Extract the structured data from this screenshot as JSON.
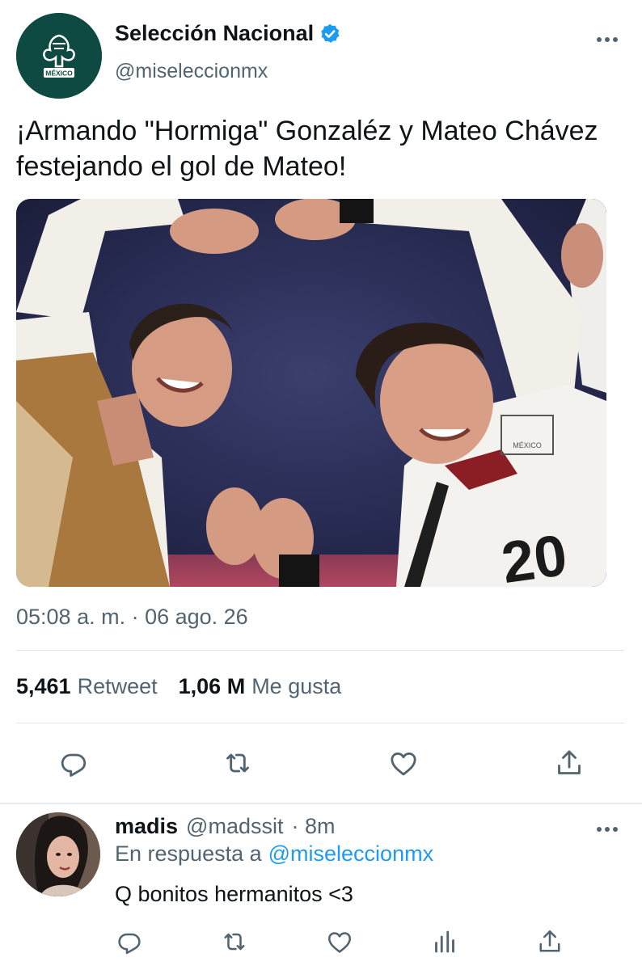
{
  "tweet": {
    "display_name": "Selección Nacional",
    "handle": "@miseleccionmx",
    "avatar_text": "MÉXICO",
    "text": "¡Armando \"Hormiga\" Gonzaléz y Mateo Chávez festejando el gol de Mateo!",
    "photo": {
      "jersey_number": "20",
      "crest_text": "MÉXICO"
    },
    "timestamp": "05:08 a. m. · 06 ago. 26",
    "retweets_count": "5,461",
    "retweets_label": "Retweet",
    "likes_count": "1,06 M",
    "likes_label": "Me gusta"
  },
  "reply": {
    "display_name": "madis",
    "handle": "@madssit",
    "time": "· 8m",
    "replying_to_label": "En respuesta a",
    "replying_to_handle": "@miseleccionmx",
    "text": "Q bonitos hermanitos <3"
  },
  "colors": {
    "verified": "#1d9bf0",
    "link": "#1d9bf0",
    "secondary_text": "#536471",
    "icon": "#536471"
  },
  "icons": {
    "main_actions": [
      "reply-icon",
      "retweet-icon",
      "like-icon",
      "share-icon"
    ],
    "reply_actions": [
      "reply-icon",
      "retweet-icon",
      "like-icon",
      "analytics-icon",
      "share-icon"
    ]
  }
}
